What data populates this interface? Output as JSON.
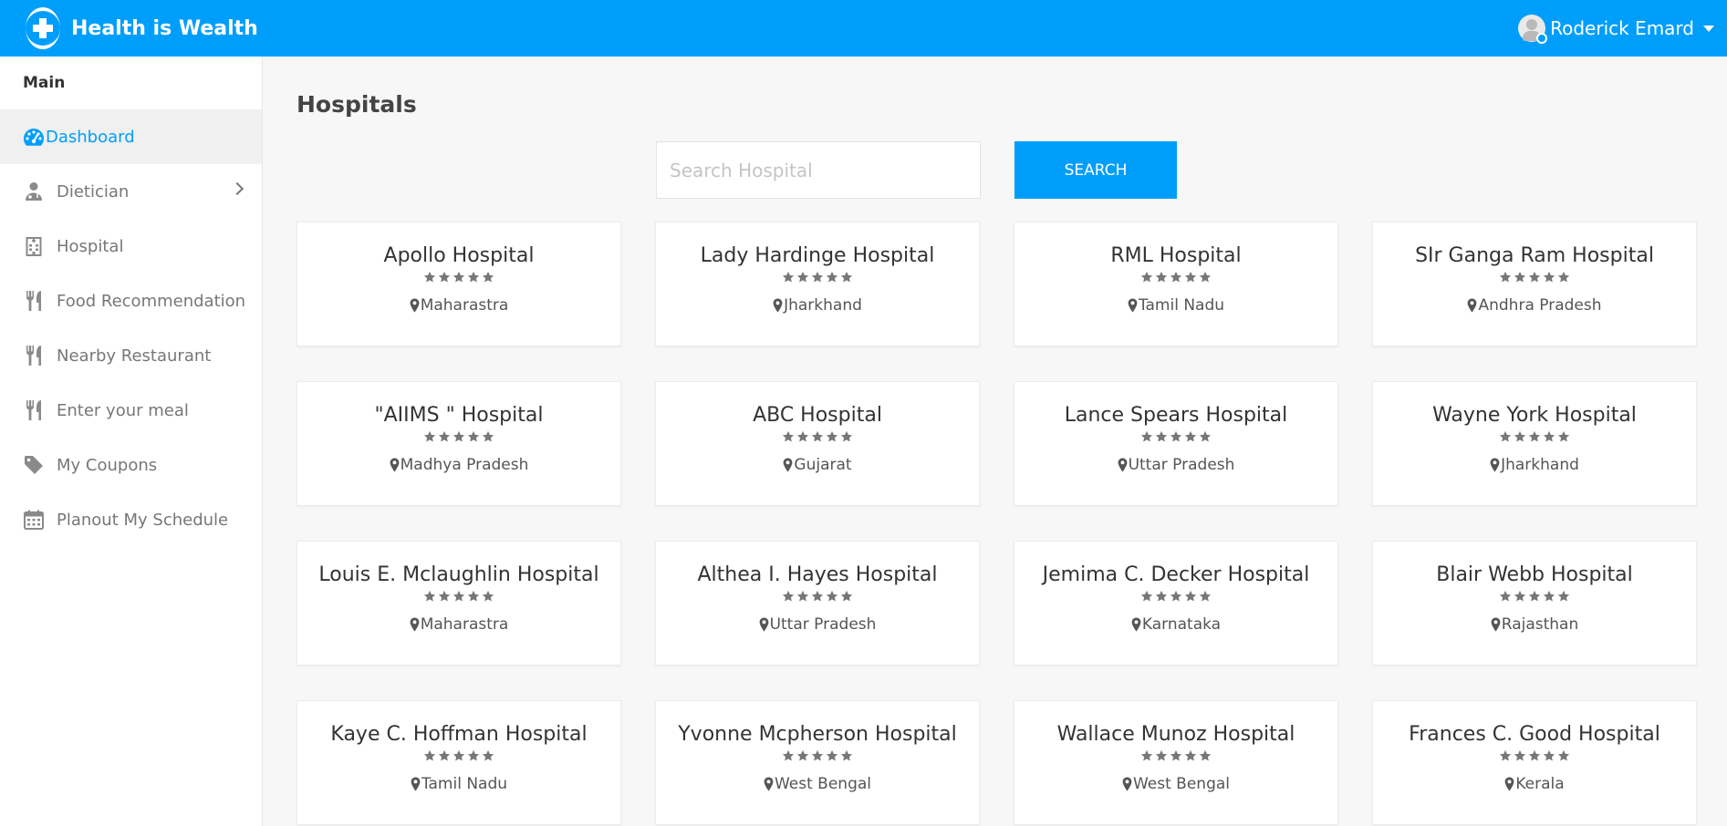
{
  "header": {
    "brand": "Health is Wealth",
    "user_name": "Roderick Emard"
  },
  "sidebar": {
    "heading": "Main",
    "items": [
      {
        "label": "Dashboard",
        "icon": "dashboard-icon",
        "active": true
      },
      {
        "label": "Dietician",
        "icon": "doctor-icon"
      },
      {
        "label": "Hospital",
        "icon": "hospital-icon"
      },
      {
        "label": "Food Recommendation",
        "icon": "cutlery-icon"
      },
      {
        "label": "Nearby Restaurant",
        "icon": "cutlery-icon"
      },
      {
        "label": "Enter your meal",
        "icon": "cutlery-icon"
      },
      {
        "label": "My Coupons",
        "icon": "tag-icon"
      },
      {
        "label": "Planout My Schedule",
        "icon": "calendar-icon"
      }
    ]
  },
  "main": {
    "title": "Hospitals",
    "search": {
      "placeholder": "Search Hospital",
      "value": "",
      "button_label": "SEARCH"
    },
    "hospitals": [
      {
        "name": "Apollo Hospital",
        "location": "Maharastra",
        "rating": 5
      },
      {
        "name": "Lady Hardinge Hospital",
        "location": "Jharkhand",
        "rating": 5
      },
      {
        "name": "RML Hospital",
        "location": "Tamil Nadu",
        "rating": 5
      },
      {
        "name": "SIr Ganga Ram Hospital",
        "location": "Andhra Pradesh",
        "rating": 5
      },
      {
        "name": "\"AIIMS \" Hospital",
        "location": "Madhya Pradesh",
        "rating": 5
      },
      {
        "name": "ABC Hospital",
        "location": "Gujarat",
        "rating": 5
      },
      {
        "name": "Lance Spears Hospital",
        "location": "Uttar Pradesh",
        "rating": 5
      },
      {
        "name": "Wayne York Hospital",
        "location": "Jharkhand",
        "rating": 5
      },
      {
        "name": "Louis E. Mclaughlin Hospital",
        "location": "Maharastra",
        "rating": 5
      },
      {
        "name": "Althea I. Hayes Hospital",
        "location": "Uttar Pradesh",
        "rating": 5
      },
      {
        "name": "Jemima C. Decker Hospital",
        "location": "Karnataka",
        "rating": 5
      },
      {
        "name": "Blair Webb Hospital",
        "location": "Rajasthan",
        "rating": 5
      },
      {
        "name": "Kaye C. Hoffman Hospital",
        "location": "Tamil Nadu",
        "rating": 5
      },
      {
        "name": "Yvonne Mcpherson Hospital",
        "location": "West Bengal",
        "rating": 5
      },
      {
        "name": "Wallace Munoz Hospital",
        "location": "West Bengal",
        "rating": 5
      },
      {
        "name": "Frances C. Good Hospital",
        "location": "Kerala",
        "rating": 5
      }
    ]
  },
  "colors": {
    "accent": "#009efb",
    "star": "#777777",
    "sidebar_text": "#777777"
  }
}
